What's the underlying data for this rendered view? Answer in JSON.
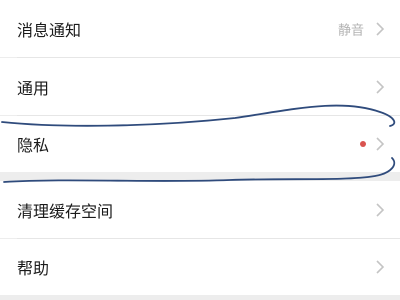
{
  "settings": {
    "items": [
      {
        "label": "消息通知",
        "value": "静音"
      },
      {
        "label": "通用"
      },
      {
        "label": "隐私",
        "badge": "red-dot",
        "badge_color": "#d9534f"
      },
      {
        "label": "清理缓存空间"
      },
      {
        "label": "帮助"
      }
    ],
    "chevron_icon": "chevron-right-icon",
    "annotation_color": "#2f4b7c"
  }
}
